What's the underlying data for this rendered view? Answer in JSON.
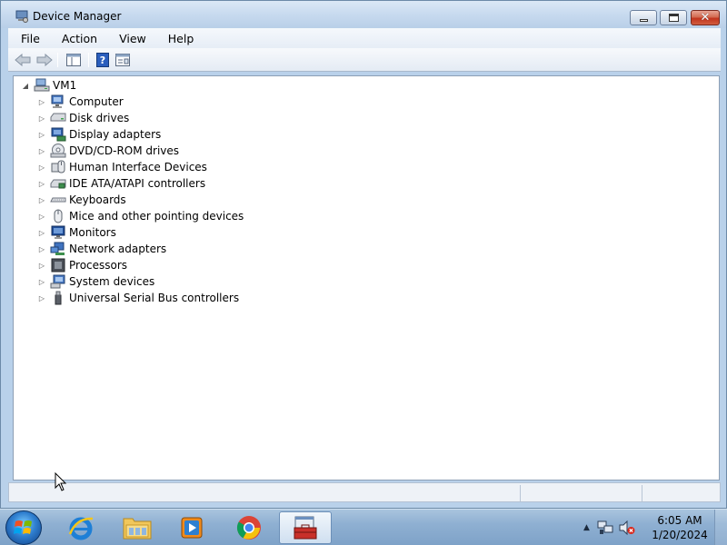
{
  "window": {
    "title": "Device Manager",
    "minimize_icon": "minimize-icon",
    "maximize_icon": "maximize-icon",
    "close_icon": "close-icon"
  },
  "menu": [
    "File",
    "Action",
    "View",
    "Help"
  ],
  "toolbar": {
    "buttons": [
      "back-arrow-icon",
      "forward-arrow-icon",
      "show-hide-console-tree-icon",
      "help-icon",
      "properties-icon"
    ]
  },
  "tree": {
    "root": "VM1",
    "items": [
      {
        "label": "Computer",
        "icon": "computer-icon"
      },
      {
        "label": "Disk drives",
        "icon": "disk-drive-icon"
      },
      {
        "label": "Display adapters",
        "icon": "display-adapter-icon"
      },
      {
        "label": "DVD/CD-ROM drives",
        "icon": "dvd-drive-icon"
      },
      {
        "label": "Human Interface Devices",
        "icon": "hid-icon"
      },
      {
        "label": "IDE ATA/ATAPI controllers",
        "icon": "ide-controller-icon"
      },
      {
        "label": "Keyboards",
        "icon": "keyboard-icon"
      },
      {
        "label": "Mice and other pointing devices",
        "icon": "mouse-icon"
      },
      {
        "label": "Monitors",
        "icon": "monitor-icon"
      },
      {
        "label": "Network adapters",
        "icon": "network-adapter-icon"
      },
      {
        "label": "Processors",
        "icon": "processor-icon"
      },
      {
        "label": "System devices",
        "icon": "system-devices-icon"
      },
      {
        "label": "Universal Serial Bus controllers",
        "icon": "usb-icon"
      }
    ]
  },
  "taskbar": {
    "apps": [
      "internet-explorer-icon",
      "file-explorer-icon",
      "media-player-icon",
      "chrome-icon",
      "device-manager-taskbar-icon"
    ],
    "active_app": "device-manager-taskbar-icon",
    "clock": {
      "time": "6:05 AM",
      "date": "1/20/2024"
    }
  },
  "colors": {
    "window_frame": "#b9d1ea",
    "close_button": "#c2351e",
    "taskbar": "#8fb0d2"
  }
}
